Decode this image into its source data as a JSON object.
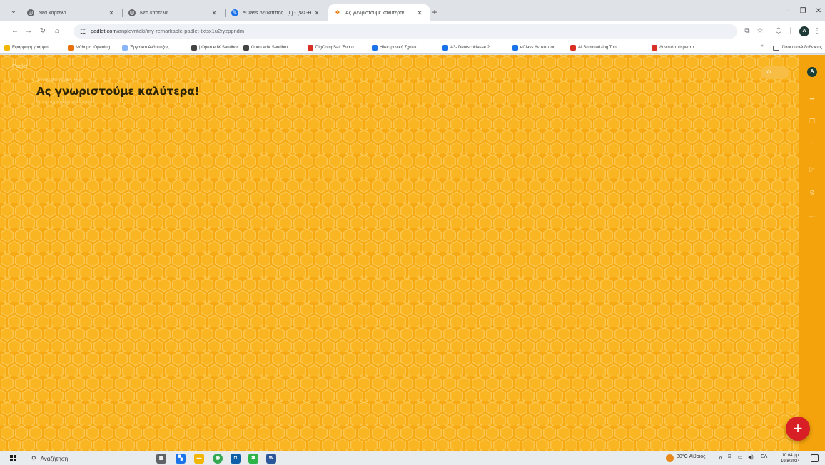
{
  "browser": {
    "tabs": [
      {
        "title": "Νέα καρτέλα",
        "active": false
      },
      {
        "title": "Νέα καρτέλα",
        "active": false
      },
      {
        "title": "eClass Λευκιππος | [Γ] - (ΨΣ-Η",
        "active": false
      },
      {
        "title": "Ας γνωριστούμε καλύτερα!",
        "active": true
      }
    ],
    "url_host": "padlet.com",
    "url_path": "/anplevritaki/my-remarkable-padlet-txtsx1u2ryzppndm",
    "bookmarks": [
      {
        "label": "Εφαρμογή γραμματ...",
        "color": "#f2b705"
      },
      {
        "label": "Μάθημα: Opening...",
        "color": "#e8710a"
      },
      {
        "label": "Έργα και Ανάπτυξης...",
        "color": "#8ab4f8"
      },
      {
        "label": "| Open edX Sandbox",
        "color": "#444444"
      },
      {
        "label": "Open edX Sandbox...",
        "color": "#444444"
      },
      {
        "label": "DigCompSat: Ένα ο...",
        "color": "#d93025"
      },
      {
        "label": "Ηλεκτρονική Σχολικ...",
        "color": "#1a73e8"
      },
      {
        "label": "A3- Deutschklasse 2...",
        "color": "#1a73e8"
      },
      {
        "label": "eClass Λευκιππος",
        "color": "#1a73e8"
      },
      {
        "label": "AI Summarizing Too...",
        "color": "#d93025"
      },
      {
        "label": "Δυνατότητα μεταπ...",
        "color": "#d93025"
      }
    ],
    "bookmarks_more": "»",
    "bookmarks_folder": "Όλοι οι σελιδοδείκτες"
  },
  "padlet": {
    "logo": "Padlet",
    "author_line": "Άννα Πλευρίτακη • 5m",
    "title": "Ας γνωριστούμε καλύτερα!",
    "subtitle": "Δραστηριότητα γνωριμίας",
    "user_initial": "A",
    "add_button": "+",
    "background_color": "#f6a912",
    "accent_color": "#d91f26"
  },
  "taskbar": {
    "search_text": "Αναζήτηση",
    "weather": "30°C Αίθριος",
    "language": "ΕΛ",
    "time": "10:04 μμ",
    "date": "19/8/2024"
  }
}
